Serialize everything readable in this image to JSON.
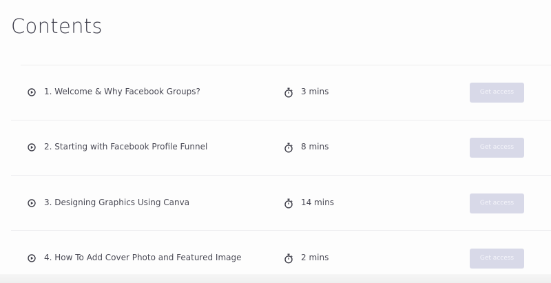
{
  "page": {
    "title": "Contents"
  },
  "lessons": [
    {
      "title": "1. Welcome & Why Facebook Groups?",
      "duration": "3 mins",
      "button_label": "Get access"
    },
    {
      "title": "2. Starting with Facebook Profile Funnel",
      "duration": "8 mins",
      "button_label": "Get access"
    },
    {
      "title": "3. Designing Graphics Using Canva",
      "duration": "14 mins",
      "button_label": "Get access"
    },
    {
      "title": "4. How To Add Cover Photo and Featured Image",
      "duration": "2 mins",
      "button_label": "Get access"
    }
  ],
  "colors": {
    "title_text": "#3d3d4a",
    "body_text": "#4a4a55",
    "button_bg": "#d8d9e8",
    "button_text": "#f4f4fa",
    "divider": "#ececee"
  },
  "icons": {
    "lesson": "play-circle-icon",
    "duration": "stopwatch-icon"
  }
}
